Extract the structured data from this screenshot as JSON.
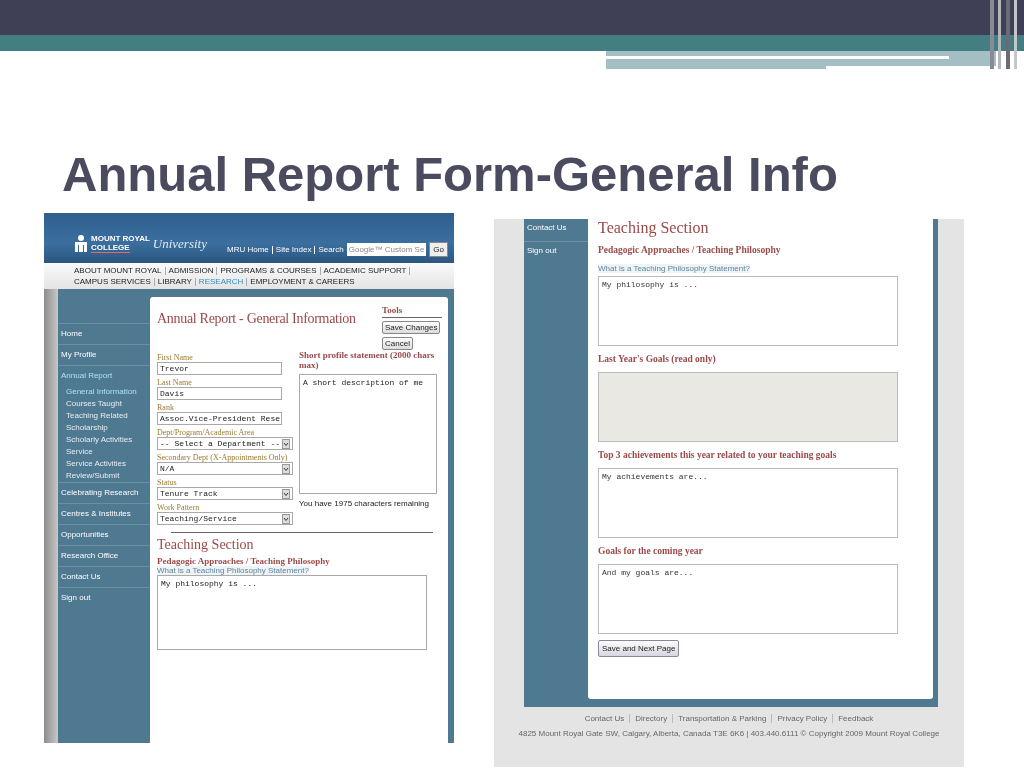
{
  "slide": {
    "title": "Annual Report Form-General Info"
  },
  "left_screenshot": {
    "header": {
      "logo_line1": "MOUNT ROYAL",
      "logo_line2": "COLLEGE",
      "logo_line3": "University",
      "links": [
        "MRU Home",
        "Site Index",
        "Search"
      ],
      "search_placeholder": "Google™ Custom Se",
      "go_button": "Go"
    },
    "nav": [
      {
        "label": "ABOUT MOUNT ROYAL",
        "selected": false
      },
      {
        "label": "ADMISSION",
        "selected": false
      },
      {
        "label": "PROGRAMS & COURSES",
        "selected": false
      },
      {
        "label": "ACADEMIC SUPPORT",
        "selected": false
      },
      {
        "label": "CAMPUS SERVICES",
        "selected": false
      },
      {
        "label": "LIBRARY",
        "selected": false
      },
      {
        "label": "RESEARCH",
        "selected": true
      },
      {
        "label": "EMPLOYMENT & CAREERS",
        "selected": false
      }
    ],
    "sidebar": [
      {
        "label": "Home",
        "selected": false
      },
      {
        "label": "My Profile",
        "selected": false
      },
      {
        "label": "Annual Report",
        "selected": true,
        "children": [
          {
            "label": "General Information",
            "selected": true
          },
          {
            "label": "Courses Taught",
            "selected": false
          },
          {
            "label": "Teaching Related",
            "selected": false
          },
          {
            "label": "Scholarship",
            "selected": false
          },
          {
            "label": "Scholarly Activities",
            "selected": false
          },
          {
            "label": "Service",
            "selected": false
          },
          {
            "label": "Service Activities",
            "selected": false
          },
          {
            "label": "Review/Submit",
            "selected": false
          }
        ]
      },
      {
        "label": "Celebrating Research",
        "selected": false
      },
      {
        "label": "Centres & Institutes",
        "selected": false
      },
      {
        "label": "Opportunities",
        "selected": false
      },
      {
        "label": "Research Office",
        "selected": false
      },
      {
        "label": "Contact Us",
        "selected": false
      },
      {
        "label": "Sign out",
        "selected": false
      }
    ],
    "page_title": "Annual Report - General Information",
    "tools": {
      "title": "Tools",
      "buttons": [
        "Save Changes",
        "Cancel"
      ]
    },
    "fields": [
      {
        "kind": "text",
        "label": "First Name",
        "value": "Trevor"
      },
      {
        "kind": "text",
        "label": "Last Name",
        "value": "Davis"
      },
      {
        "kind": "text",
        "label": "Rank",
        "value": "Assoc.Vice-President Rese"
      },
      {
        "kind": "select",
        "label": "Dept/Program/Academic Area",
        "value": "-- Select a Department --"
      },
      {
        "kind": "select",
        "label": "Secondary Dept (X-Appointments Only)",
        "value": "N/A"
      },
      {
        "kind": "select",
        "label": "Status",
        "value": "Tenure Track"
      },
      {
        "kind": "select",
        "label": "Work Pattern",
        "value": "Teaching/Service"
      }
    ],
    "profile": {
      "title": "Short profile statement (2000 chars max)",
      "value": "A short description of me",
      "remaining": "You have 1975 characters remaining"
    },
    "teaching": {
      "title": "Teaching Section",
      "subtitle": "Pedagogic Approaches / Teaching Philosophy",
      "link": "What is a Teaching Philosophy Statement?",
      "value": "My philosophy is ..."
    }
  },
  "right_screenshot": {
    "sidebar": [
      {
        "label": "Contact Us"
      },
      {
        "label": "Sign out"
      }
    ],
    "section_title": "Teaching Section",
    "questions": [
      {
        "title": "Pedagogic Approaches / Teaching Philosophy",
        "link": "What is a Teaching Philosophy Statement?",
        "value": "My philosophy is ...",
        "read_only": false
      },
      {
        "title": "Last Year's Goals (read only)",
        "read_only": true
      },
      {
        "title": "Top 3 achievements this year related to your teaching goals",
        "value": "My achievements are...",
        "read_only": false
      },
      {
        "title": "Goals for the coming year",
        "value": "And my goals are...",
        "read_only": false
      }
    ],
    "save_button": "Save and Next Page",
    "footer_links": [
      "Contact Us",
      "Directory",
      "Transportation & Parking",
      "Privacy Policy",
      "Feedback"
    ],
    "footer_address": "4825 Mount Royal Gate SW, Calgary, Alberta, Canada T3E 6K6 | 403.440.6111    © Copyright 2009 Mount Royal College"
  }
}
